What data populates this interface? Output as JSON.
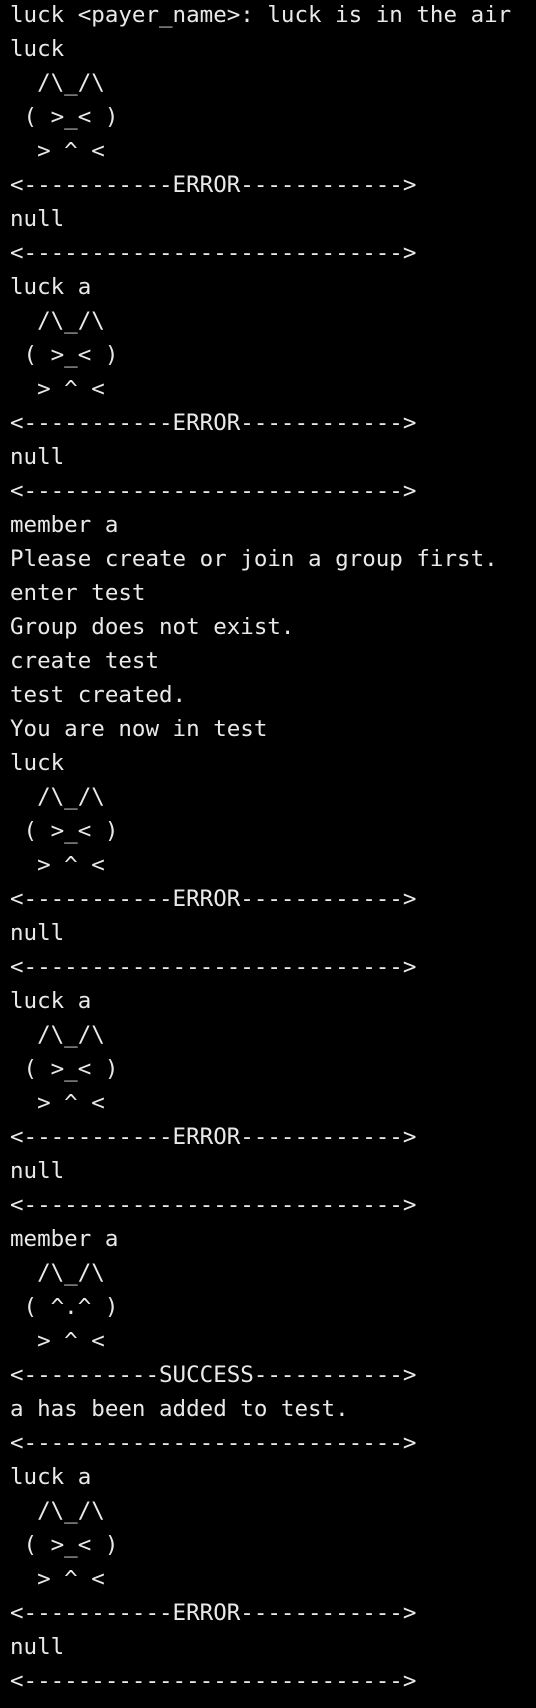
{
  "terminal": {
    "background": "#000000",
    "foreground": "#e9e9e9",
    "lines": [
      "luck <payer_name>: luck is in the air",
      "luck",
      "  /\\_/\\",
      " ( >_< )",
      "  > ^ <",
      "<-----------ERROR------------>",
      "null",
      "<---------------------------->",
      "luck a",
      "  /\\_/\\",
      " ( >_< )",
      "  > ^ <",
      "<-----------ERROR------------>",
      "null",
      "<---------------------------->",
      "member a",
      "Please create or join a group first.",
      "enter test",
      "Group does not exist.",
      "create test",
      "test created.",
      "You are now in test",
      "luck",
      "  /\\_/\\",
      " ( >_< )",
      "  > ^ <",
      "<-----------ERROR------------>",
      "null",
      "<---------------------------->",
      "luck a",
      "  /\\_/\\",
      " ( >_< )",
      "  > ^ <",
      "<-----------ERROR------------>",
      "null",
      "<---------------------------->",
      "member a",
      "  /\\_/\\",
      " ( ^.^ )",
      "  > ^ <",
      "<----------SUCCESS----------->",
      "a has been added to test.",
      "<---------------------------->",
      "luck a",
      "  /\\_/\\",
      " ( >_< )",
      "  > ^ <",
      "<-----------ERROR------------>",
      "null",
      "<---------------------------->"
    ]
  }
}
